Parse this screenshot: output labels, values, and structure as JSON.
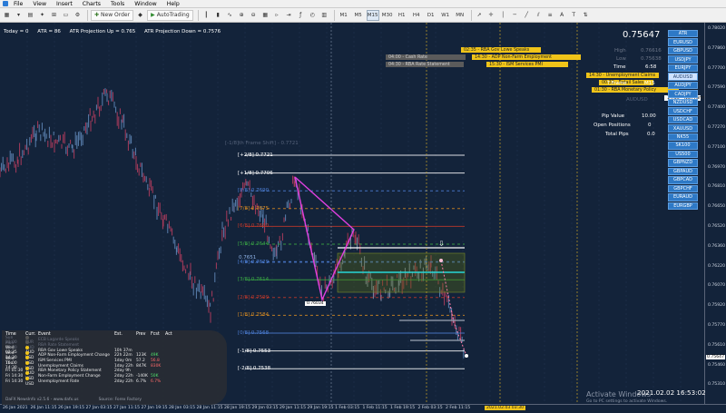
{
  "menu": [
    "File",
    "View",
    "Insert",
    "Charts",
    "Tools",
    "Window",
    "Help"
  ],
  "toolbar": {
    "new_order_label": "New Order",
    "autotrading_label": "AutoTrading",
    "timeframes": [
      "M1",
      "M5",
      "M15",
      "M30",
      "H1",
      "H4",
      "D1",
      "W1",
      "MN"
    ],
    "active_timeframe": "M15"
  },
  "info_line": {
    "today": "Today = 0",
    "atr": "ATR = 86",
    "proj_up": "ATR Projection Up = 0.765",
    "proj_down": "ATR Projection Down = 0.7576"
  },
  "panel": {
    "current_price": "0.75647",
    "high_label": "High",
    "high_value": "0.76616",
    "low_label": "Low",
    "low_value": "0.75638",
    "time_label": "Time",
    "time_value": "6:58",
    "tframe_label": "T.Frame",
    "tframe_value": "M15",
    "symbol": "AUDUSD",
    "pip_value_label": "Pip Value",
    "pip_value": "10.00",
    "open_positions_label": "Open Positions",
    "open_positions": "0",
    "total_pips_label": "Total Pips",
    "total_pips": "0.0"
  },
  "symbols": [
    "ATR",
    "EURUSD",
    "GBPUSD",
    "USDJPY",
    "EURJPY",
    "AUDUSD",
    "AUDJPY",
    "CADJPY",
    "NZDUSD",
    "USDCHF",
    "USDCAD",
    "XAUUSD",
    "NK55",
    "SK100",
    "US500",
    "GBPNZD",
    "GBPAUD",
    "GBPCAD",
    "GBPCHF",
    "EURAUD",
    "EURGBP"
  ],
  "highlight_symbol": "AUDUSD",
  "news_bars": [
    {
      "text": "04:00 - Cash Rate",
      "bg": "#5b5b5b",
      "color": "#cfcfcf"
    },
    {
      "text": "04:30 - RBA Rate Statement",
      "bg": "#5b5b5b",
      "color": "#cfcfcf"
    },
    {
      "text": "02:35 - RBA Gov Lowe Speaks",
      "bg": "#f0c419",
      "color": "#222"
    },
    {
      "text": "14:30 - ADP Non-Farm Employment",
      "bg": "#f0c419",
      "color": "#222"
    },
    {
      "text": "15:30 - ISM Services PMI",
      "bg": "#f0c419",
      "color": "#222"
    },
    {
      "text": "14:30 - Unemployment Claims",
      "bg": "#f0c419",
      "color": "#222"
    },
    {
      "text": "00:30 - Retail Sales",
      "bg": "#f0c419",
      "color": "#222"
    },
    {
      "text": "01:30 - RBA Monetary Policy",
      "bg": "#f0c419",
      "color": "#222"
    },
    {
      "text": "14:30 - Non-Farm",
      "bg": "#ffffff",
      "color": "#222"
    }
  ],
  "murrey_levels": [
    {
      "label": "[+2/8]",
      "value": "0.7721",
      "color": "#ffffff"
    },
    {
      "label": "[+1/8]",
      "value": "0.7706",
      "color": "#ffffff"
    },
    {
      "label": "[8/8]",
      "value": "0.7690",
      "color": "#4d7fd6"
    },
    {
      "label": "[7/8]",
      "value": "0.7675",
      "color": "#d68a22"
    },
    {
      "label": "[6/8]",
      "value": "0.7660",
      "color": "#c0392b"
    },
    {
      "label": "[5/8]",
      "value": "0.7644",
      "color": "#3aa845"
    },
    {
      "label": "[4/8]",
      "value": "0.7629",
      "color": "#4d7fd6"
    },
    {
      "label": "[3/8]",
      "value": "0.7614",
      "color": "#3aa845"
    },
    {
      "label": "[2/8]",
      "value": "0.7599",
      "color": "#c0392b"
    },
    {
      "label": "[1/8]",
      "value": "0.7584",
      "color": "#d68a22"
    },
    {
      "label": "[0/8]",
      "value": "0.7568",
      "color": "#4d7fd6"
    },
    {
      "label": "[-1/8]",
      "value": "0.7553",
      "color": "#ffffff"
    },
    {
      "label": "[-2/8]",
      "value": "0.7538",
      "color": "#ffffff"
    }
  ],
  "mm_header": "[-1/8]th Frame Shift] - 0.7721",
  "price_axis": [
    "0.78020",
    "0.77860",
    "0.77700",
    "0.77590",
    "0.77400",
    "0.77270",
    "0.77100",
    "0.76970",
    "0.76810",
    "0.76650",
    "0.76520",
    "0.76360",
    "0.76220",
    "0.76070",
    "0.75920",
    "0.75770",
    "0.75610",
    "0.75460",
    "0.75310"
  ],
  "price_axis_current": "0.75647",
  "time_axis": [
    "26 Jan 2021",
    "26 Jan 11:15",
    "26 Jan 19:15",
    "27 Jan 03:15",
    "27 Jan 11:15",
    "27 Jan 19:15",
    "28 Jan 03:15",
    "28 Jan 11:15",
    "28 Jan 19:15",
    "29 Jan 03:15",
    "29 Jan 11:15",
    "29 Jan 19:15",
    "1 Feb 03:15",
    "1 Feb 11:15",
    "1 Feb 19:15",
    "2 Feb 03:15",
    "2 Feb 11:15"
  ],
  "time_marker": "2021.02.03 03:30",
  "calendar": {
    "headers": [
      "Time",
      "Curr.",
      "Event",
      "Est.",
      "Prev",
      "Fcst",
      "Act"
    ],
    "rows": [
      {
        "time": "Sun 23:00",
        "curr": "EUR",
        "event": "ECB Lagarde Speaks",
        "est": "",
        "prev": "",
        "fcst": "",
        "act": "",
        "past": true
      },
      {
        "time": "Mon 04:30",
        "curr": "AUD",
        "event": "RBA Rate Statement",
        "est": "",
        "prev": "",
        "fcst": "",
        "act": "",
        "past": true
      },
      {
        "time": "Wed 02:35",
        "curr": "AUD",
        "event": "RBA Gov Lowe Speaks",
        "est": "10h 37m",
        "prev": "",
        "fcst": "",
        "act": ""
      },
      {
        "time": "Wed 14:30",
        "curr": "USD",
        "event": "ADP Non-Farm Employment Change",
        "est": "22h 22m",
        "prev": "123K",
        "fcst": "49K",
        "act": ""
      },
      {
        "time": "Wed 16:00",
        "curr": "USD",
        "event": "ISM Services PMI",
        "est": "1day 0m",
        "prev": "57.2",
        "fcst": "56.8",
        "act": ""
      },
      {
        "time": "Thu 14:30",
        "curr": "USD",
        "event": "Unemployment Claims",
        "est": "1day 22h",
        "prev": "847K",
        "fcst": "830K",
        "act": ""
      },
      {
        "time": "Fri 01:30",
        "curr": "AUD",
        "event": "RBA Monetary Policy Statement",
        "est": "2day 9h",
        "prev": "",
        "fcst": "",
        "act": ""
      },
      {
        "time": "Fri 14:30",
        "curr": "USD",
        "event": "Non-Farm Employment Change",
        "est": "2day 22h",
        "prev": "-140K",
        "fcst": "50K",
        "act": ""
      },
      {
        "time": "Fri 14:30",
        "curr": "USD",
        "event": "Unemployment Rate",
        "est": "2day 22h",
        "prev": "6.7%",
        "fcst": "6.7%",
        "act": ""
      }
    ],
    "footer": "DaFX NewsInfo v2.5.6 - www.dafx.us",
    "footer2": "Source: Forex Factory"
  },
  "zone_label": "0.7651",
  "low_box": "0.76034",
  "watermark": "Activate Windows",
  "watermark_sub": "Go to PC settings to activate Windows.",
  "clock": "2021.02.02 16:53:02"
}
